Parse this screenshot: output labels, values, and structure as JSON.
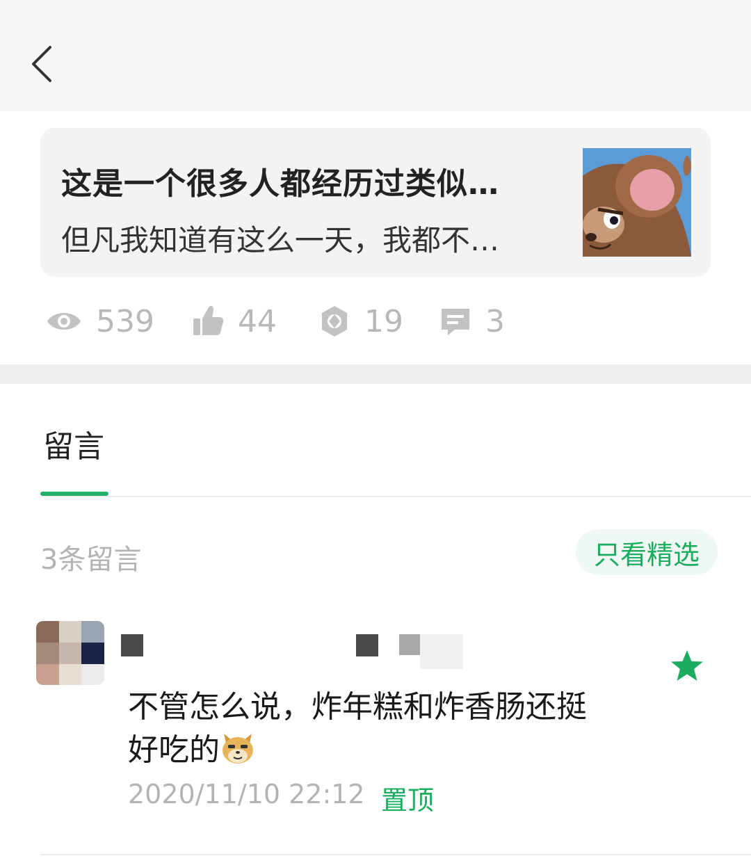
{
  "header": {
    "back_icon": "chevron-left-icon"
  },
  "article": {
    "title": "这是一个很多人都经历过类似…",
    "summary": "但凡我知道有这么一天，我都不…",
    "thumbnail": "cartoon-mouse-thumbnail"
  },
  "stats": {
    "views": "539",
    "likes": "44",
    "shares": "19",
    "comments": "3"
  },
  "tabs": [
    {
      "label": "留言",
      "active": true
    }
  ],
  "comments_section": {
    "count_label": "3条留言",
    "filter_label": "只看精选"
  },
  "comment": {
    "text_line1": "不管怎么说，炸年糕和炸香肠还挺",
    "text_line2": "好吃的",
    "emoji": "doge-emoji",
    "timestamp": "2020/11/10 22:12",
    "pinned_label": "置顶",
    "featured_icon": "star-icon"
  },
  "colors": {
    "accent": "#1aad5f",
    "muted": "#b3b3b3",
    "card_bg": "#f3f3f3"
  }
}
